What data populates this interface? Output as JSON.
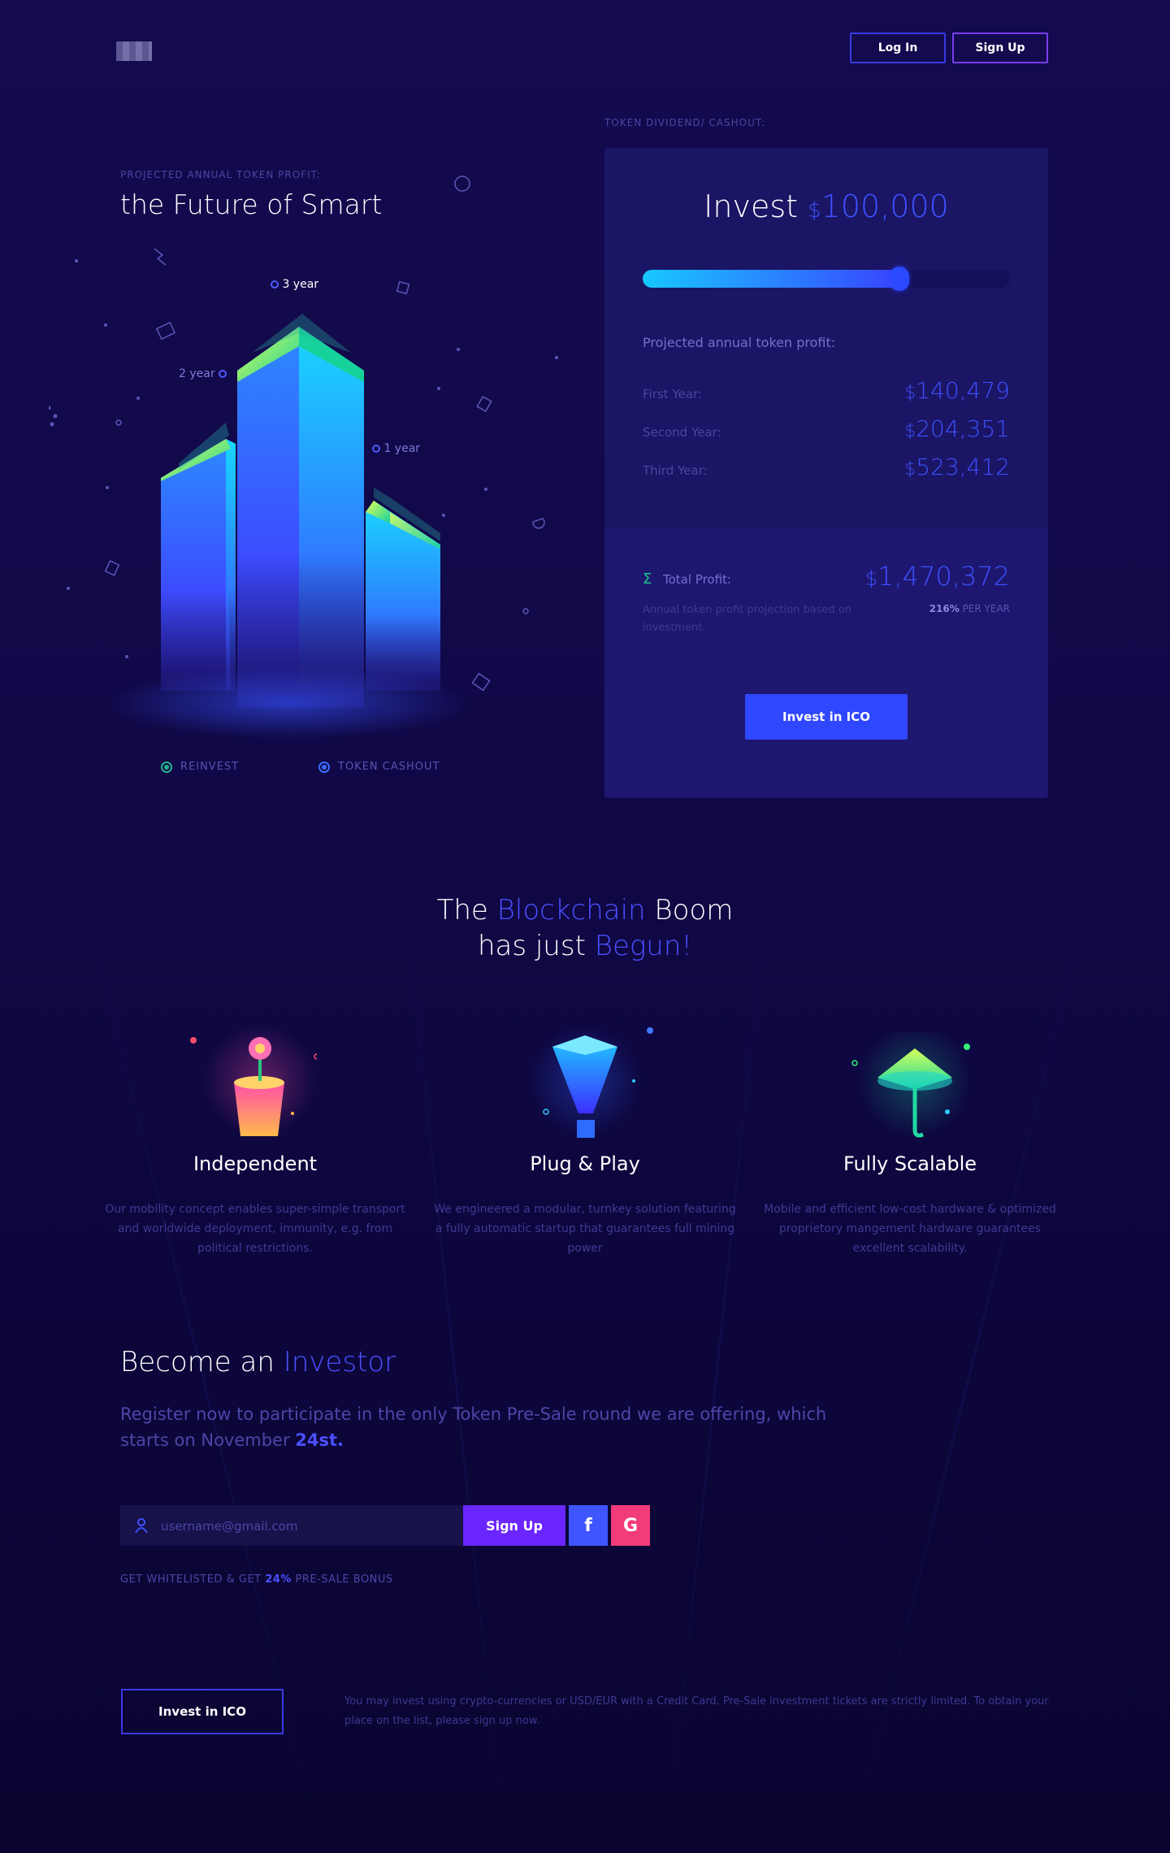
{
  "header": {
    "login_label": "Log In",
    "signup_label": "Sign Up"
  },
  "hero": {
    "eyebrow": "PROJECTED ANNUAL TOKEN PROFIT:",
    "title": "the Future of Smart",
    "towers": [
      {
        "label": "3 year"
      },
      {
        "label": "2 year"
      },
      {
        "label": "1 year"
      }
    ],
    "legend": {
      "reinvest": "REINVEST",
      "cashout": "TOKEN CASHOUT"
    }
  },
  "dividend": {
    "eyebrow": "TOKEN DIVIDEND/ CASHOUT:",
    "invest_word": "Invest",
    "currency": "$",
    "invest_amount": "100,000",
    "slider_fraction": 0.7,
    "projected_label": "Projected annual token profit:",
    "rows": [
      {
        "label": "First Year:",
        "value": "140,479"
      },
      {
        "label": "Second Year:",
        "value": "204,351"
      },
      {
        "label": "Third Year:",
        "value": "523,412"
      }
    ],
    "total_label": "Total Profit:",
    "total_value": "1,470,372",
    "note": "Annual token profit projection based on investment.",
    "percent": "216%",
    "per_year": "PER YEAR",
    "cta": "Invest in ICO"
  },
  "features": {
    "title_parts": {
      "a": "The ",
      "b": "Blockchain",
      "c": " Boom",
      "d": "has just ",
      "e": "Begun!"
    },
    "items": [
      {
        "title": "Independent",
        "desc": "Our mobility concept enables super-simple transport and worldwide deployment, immunity, e.g. from political restrictions."
      },
      {
        "title": "Plug & Play",
        "desc": "We engineered a modular, turnkey solution featuring a fully automatic startup that guarantees full mining power"
      },
      {
        "title": "Fully Scalable",
        "desc": "Mobile and efficient low-cost hardware & optimized proprietory mangement hardware guarantees excellent scalability."
      }
    ]
  },
  "investor": {
    "title_a": "Become an ",
    "title_b": "Investor",
    "desc_a": "Register now to participate in the only Token Pre-Sale round we are offering, which starts on November ",
    "desc_b": "24st.",
    "email_placeholder": "username@gmail.com",
    "signup_label": "Sign Up",
    "facebook_label": "f",
    "google_label": "G",
    "whitelist_a": "GET WHITELISTED & GET ",
    "whitelist_b": "24%",
    "whitelist_c": " PRE-SALE BONUS"
  },
  "footer": {
    "cta": "Invest in ICO",
    "note": "You may invest using crypto-currencies or USD/EUR with a Credit Card. Pre-Sale investment tickets are strictly limited. To obtain your place on the list, please sign up now."
  },
  "colors": {
    "accent": "#3c50ff",
    "purple": "#6b25ff",
    "green": "#16c38f",
    "pink": "#f23b7a"
  }
}
